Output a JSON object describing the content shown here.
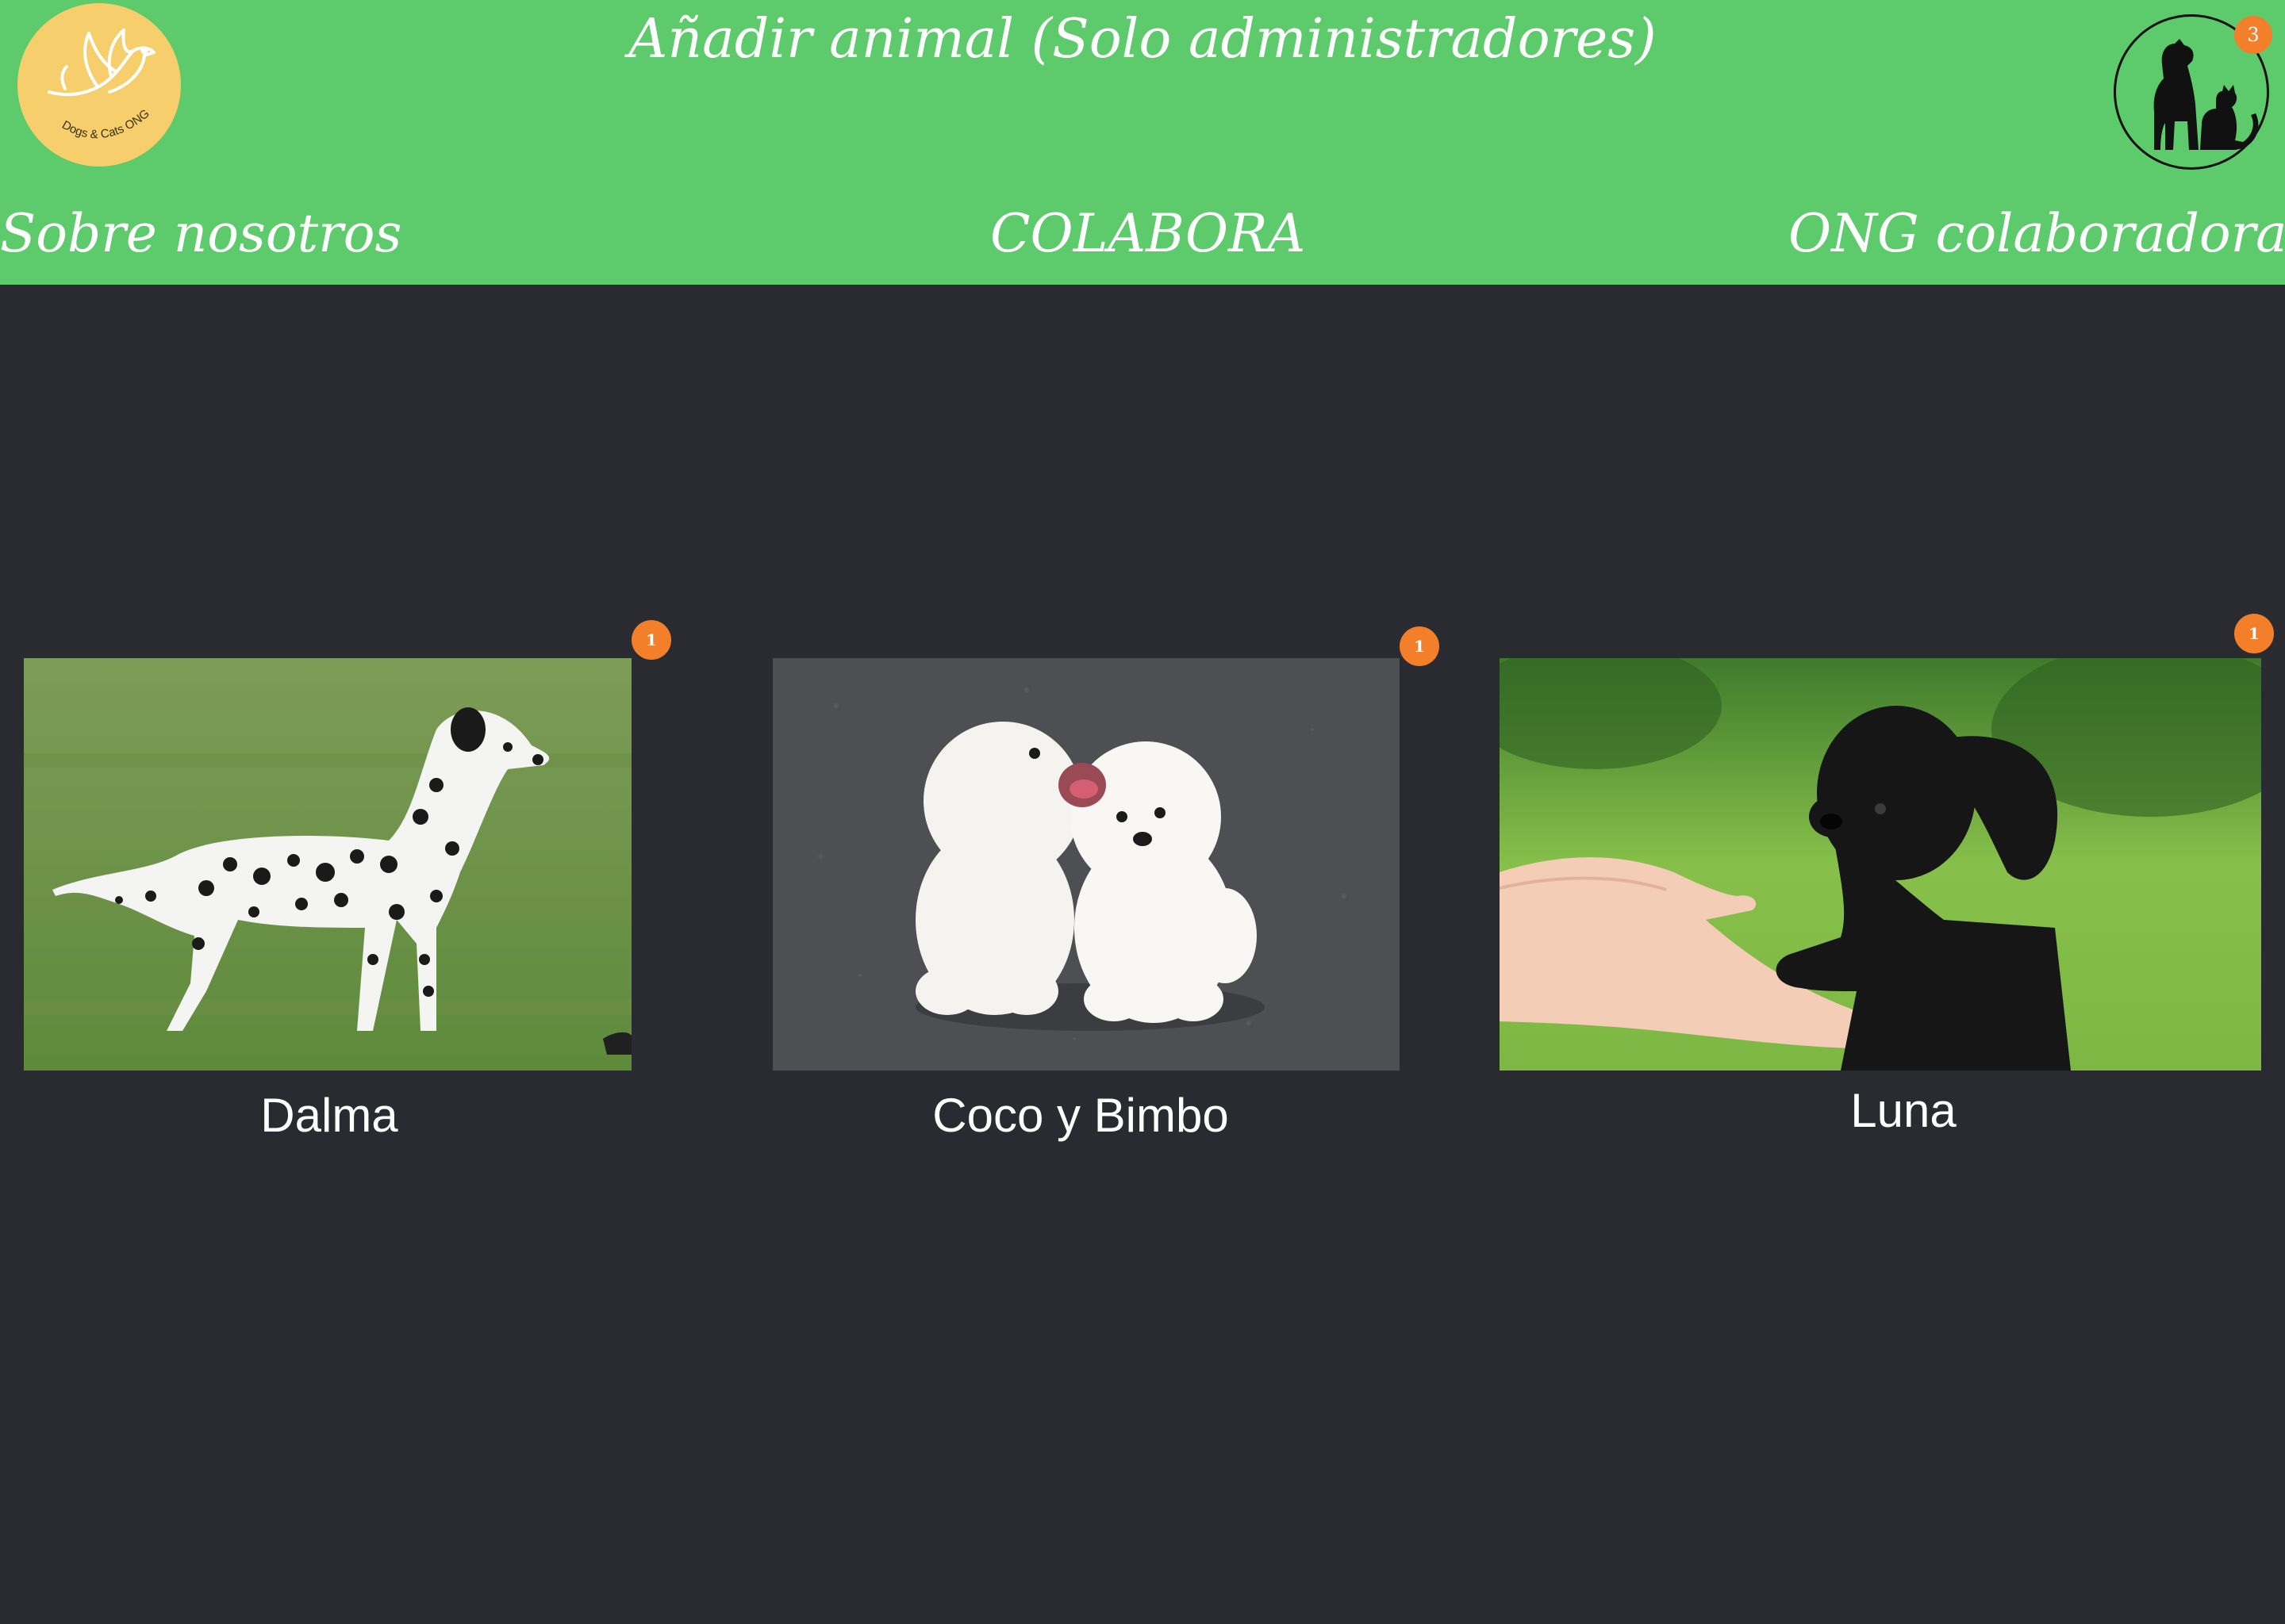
{
  "header": {
    "title": "Añadir animal (Solo administradores)",
    "logo_text": "Dogs & Cats ONG",
    "cart_icon": "dog-and-cat-silhouette-icon",
    "cart_count": "3"
  },
  "nav": {
    "about": "Sobre nosotros",
    "collaborate": "COLABORA",
    "ngos": "ONG colaboradoras"
  },
  "animals": [
    {
      "name": "Dalma",
      "image": "dalmatian-photo",
      "badge": "1"
    },
    {
      "name": "Coco y Bimbo",
      "image": "white-puppies-photo",
      "badge": "1"
    },
    {
      "name": "Luna",
      "image": "black-puppy-photo",
      "badge": "1"
    }
  ],
  "colors": {
    "header_bg": "#5dcb6b",
    "page_bg": "#2a2b30",
    "badge": "#f47f2a",
    "logo_bg": "#f6cf6c"
  }
}
